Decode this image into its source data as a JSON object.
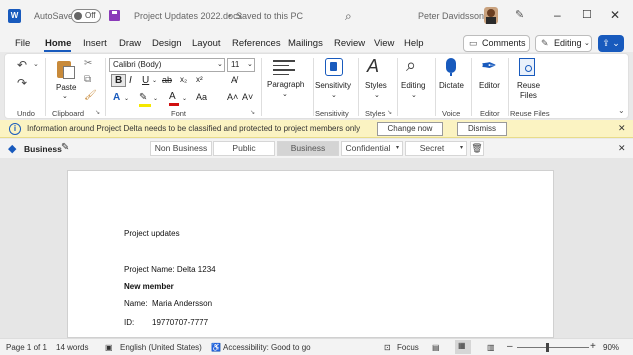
{
  "titlebar": {
    "autosave_label": "AutoSave",
    "autosave_state": "Off",
    "doc_title": "Project Updates 2022.docx",
    "saved_status": "Saved to this PC",
    "title_separator": "•",
    "user_name": "Peter Davidsson"
  },
  "menu": {
    "items": [
      "File",
      "Home",
      "Insert",
      "Draw",
      "Design",
      "Layout",
      "References",
      "Mailings",
      "Review",
      "View",
      "Help"
    ],
    "comments_label": "Comments",
    "editing_label": "Editing"
  },
  "ribbon": {
    "undo_group": "Undo",
    "clipboard_group": "Clipboard",
    "paste_label": "Paste",
    "font_group": "Font",
    "font_name": "Calibri (Body)",
    "font_size": "11",
    "paragraph_label": "Paragraph",
    "sensitivity_label": "Sensitivity",
    "sensitivity_group": "Sensitivity",
    "styles_label": "Styles",
    "styles_group": "Styles",
    "editing_label": "Editing",
    "dictate_label": "Dictate",
    "voice_group": "Voice",
    "editor_label": "Editor",
    "editor_group": "Editor",
    "reuse_label_1": "Reuse",
    "reuse_label_2": "Files",
    "reuse_group": "Reuse Files"
  },
  "infobar": {
    "message": "Information around Project Delta needs to be classified and protected to project members only",
    "change_now": "Change now",
    "dismiss": "Dismiss"
  },
  "labelbar": {
    "current_label": "Business",
    "options": [
      "Non Business",
      "Public",
      "Business",
      "Confidential",
      "Secret"
    ]
  },
  "document": {
    "heading": "Project updates",
    "project_name": "Project Name: Delta 1234",
    "new_member": "New member",
    "name_label": "Name:",
    "name_value": "Maria Andersson",
    "id_label": "ID:",
    "id_value": "19770707-7777"
  },
  "status": {
    "page": "Page 1 of 1",
    "words": "14 words",
    "language": "English (United States)",
    "accessibility": "Accessibility: Good to go",
    "focus": "Focus",
    "zoom": "90%"
  }
}
